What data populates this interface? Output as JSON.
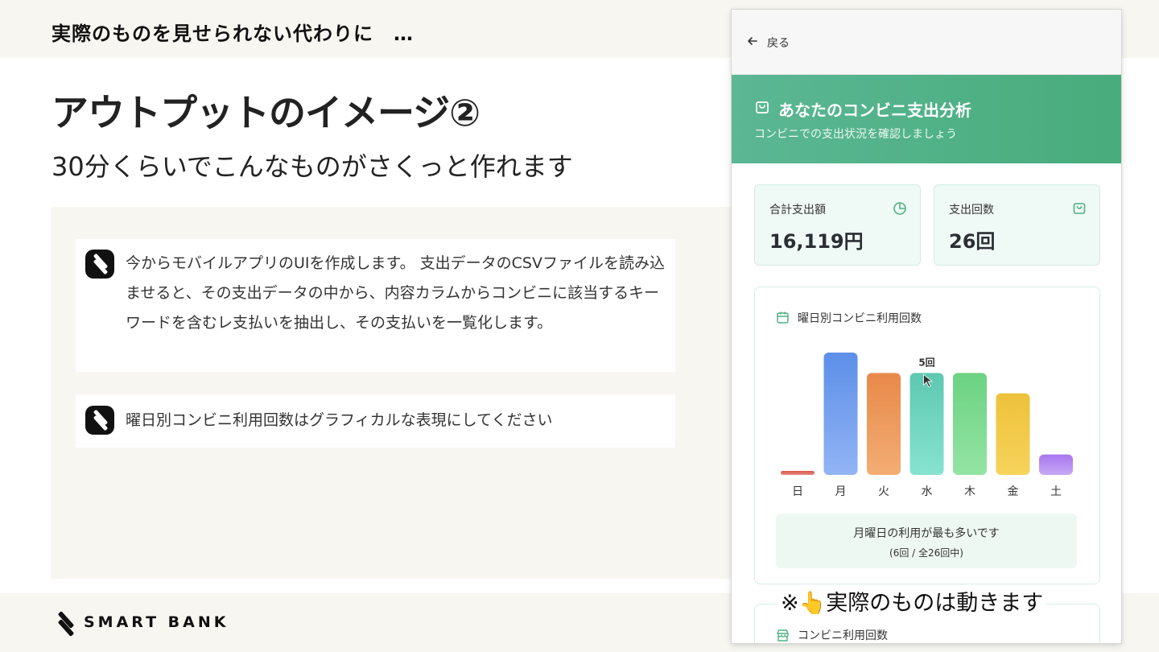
{
  "slide": {
    "header": "実際のものを見せられない代わりに　…",
    "title": "アウトプットのイメージ②",
    "subtitle": "30分くらいでこんなものがさくっと作れます",
    "prompts": [
      "今からモバイルアプリのUIを作成します。 支出データのCSVファイルを読み込ませると、その支出データの中から、内容カラムからコンビニに該当するキーワードを含むレ支払いを抽出し、その支払いを一覧化します。",
      "曜日別コンビニ利用回数はグラフィカルな表現にしてください"
    ],
    "brand": "SMART BANK",
    "overlay_note": "※👆実際のものは動きます"
  },
  "app": {
    "back_label": "戻る",
    "banner_title": "あなたのコンビニ支出分析",
    "banner_subtitle": "コンビニでの支出状況を確認しましょう",
    "stats": [
      {
        "label": "合計支出額",
        "value": "16,119円",
        "icon": "pie-chart-icon"
      },
      {
        "label": "支出回数",
        "value": "26回",
        "icon": "shopping-bag-icon"
      }
    ],
    "chart_title": "曜日別コンビニ利用回数",
    "summary_main": "月曜日の利用が最も多いです",
    "summary_sub": "(6回 / 全26回中)",
    "next_card_title": "コンビニ利用回数"
  },
  "colors": {
    "banner_green": "#4fb184",
    "text_dark": "#222222",
    "panel_beige": "#f7f6f1"
  },
  "chart_data": {
    "type": "bar",
    "title": "曜日別コンビニ利用回数",
    "categories": [
      "日",
      "月",
      "火",
      "水",
      "木",
      "金",
      "土"
    ],
    "values": [
      0,
      6,
      5,
      5,
      5,
      4,
      1
    ],
    "ylim": [
      0,
      6
    ],
    "colors": [
      [
        "#e58a80",
        "#d9574c"
      ],
      [
        "#92b4f5",
        "#5c8fe8"
      ],
      [
        "#f3ad73",
        "#e8894a"
      ],
      [
        "#86e3cf",
        "#5ec8b0"
      ],
      [
        "#94e4a4",
        "#6bd281"
      ],
      [
        "#f7d35a",
        "#edc13b"
      ],
      [
        "#c7a8f5",
        "#a876ee"
      ]
    ],
    "tooltip": {
      "category": "水",
      "label": "5回"
    },
    "grid": false,
    "legend": "none"
  }
}
